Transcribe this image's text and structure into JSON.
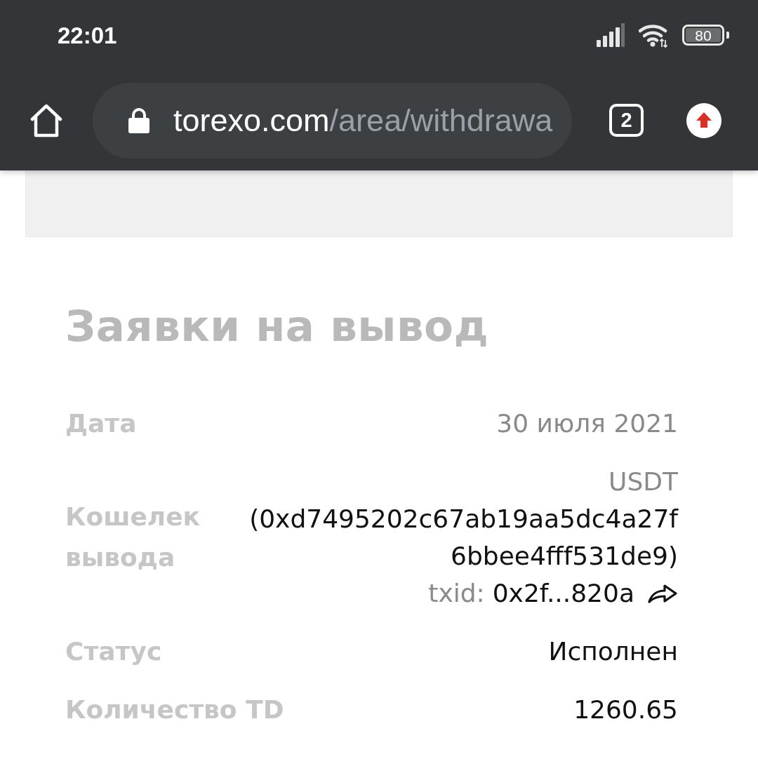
{
  "status_bar": {
    "time": "22:01",
    "battery": "80"
  },
  "browser": {
    "url_host": "torexo.com",
    "url_path": "/area/withdrawa",
    "tab_count": "2"
  },
  "page": {
    "title": "Заявки на вывод",
    "rows": [
      {
        "kind": "date",
        "label": "Дата",
        "value": "30 июля 2021"
      },
      {
        "kind": "wallet",
        "label": "Кошелек вывода",
        "currency": "USDT",
        "address_lines": [
          "(0xd7495202c67ab19aa5dc4a27f",
          "6bbee4fff531de9)"
        ],
        "txid_label": "txid:",
        "txid": "0x2f...820a"
      },
      {
        "kind": "status",
        "label": "Статус",
        "value": "Исполнен"
      },
      {
        "kind": "amount",
        "label": "Количество TD",
        "value": "1260.65"
      }
    ]
  }
}
